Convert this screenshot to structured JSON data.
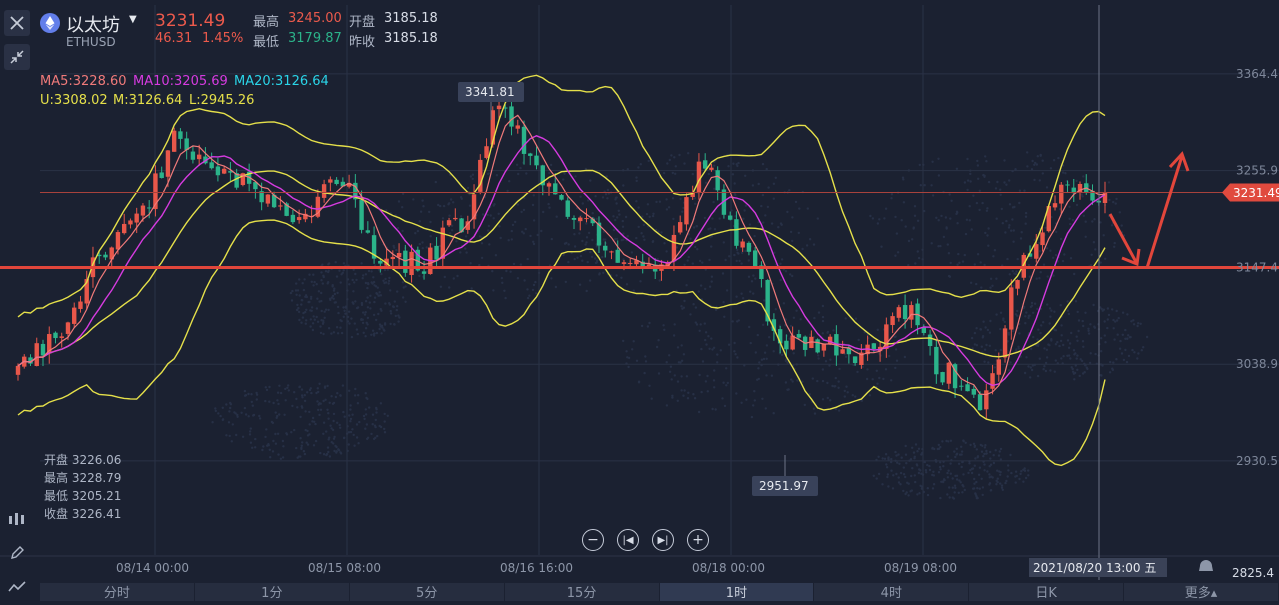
{
  "header": {
    "name": "以太坊",
    "symbol": "ETHUSD",
    "price": "3231.49",
    "change": "46.31",
    "change_pct": "1.45%",
    "high_label": "最高",
    "high": "3245.00",
    "open_label": "开盘",
    "open": "3185.18",
    "low_label": "最低",
    "low": "3179.87",
    "prev_label": "昨收",
    "prev": "3185.18"
  },
  "indicators": {
    "ma5": "MA5:3228.60",
    "ma10": "MA10:3205.69",
    "ma20": "MA20:3126.64",
    "u": "U:3308.02",
    "m": "M:3126.64",
    "l": "L:2945.26"
  },
  "ohlc_box": {
    "open": "开盘 3226.06",
    "high": "最高 3228.79",
    "low": "最低 3205.21",
    "close": "收盘 3226.41"
  },
  "price_axis": [
    "3364.4",
    "3255.9",
    "3147.4",
    "3038.9",
    "2930.5"
  ],
  "time_axis": [
    "08/14 00:00",
    "08/15 08:00",
    "08/16 16:00",
    "08/18 00:00",
    "08/19 08:00"
  ],
  "current_price_tag": "3231.49",
  "crosshair_time": "2021/08/20 13:00 五",
  "bottom_clip_price": "2825.4",
  "callouts": {
    "peak": "3341.81",
    "trough": "2951.97"
  },
  "tabs": [
    "分时",
    "1分",
    "5分",
    "15分",
    "1时",
    "4时",
    "日K",
    "更多▴"
  ],
  "active_tab": "1时",
  "colors": {
    "up": "#e8574a",
    "down": "#2bb38a",
    "bg": "#1b2131",
    "ma5": "#f07a7a",
    "ma10": "#d63be0",
    "ma20": "#2ad4e8",
    "boll": "#e5e04a"
  },
  "chart_data": {
    "type": "candlestick",
    "interval": "1h",
    "ylim": [
      2825,
      3380
    ],
    "peak": 3341.81,
    "trough": 2951.97,
    "support_level": 3147.4,
    "current": 3231.49,
    "key_closes": [
      3040,
      3070,
      3150,
      3215,
      3290,
      3260,
      3230,
      3200,
      3250,
      3160,
      3150,
      3200,
      3330,
      3250,
      3200,
      3160,
      3150,
      3260,
      3170,
      3060,
      3060,
      3050,
      3100,
      3030,
      3000,
      3150,
      3240,
      3231
    ]
  }
}
